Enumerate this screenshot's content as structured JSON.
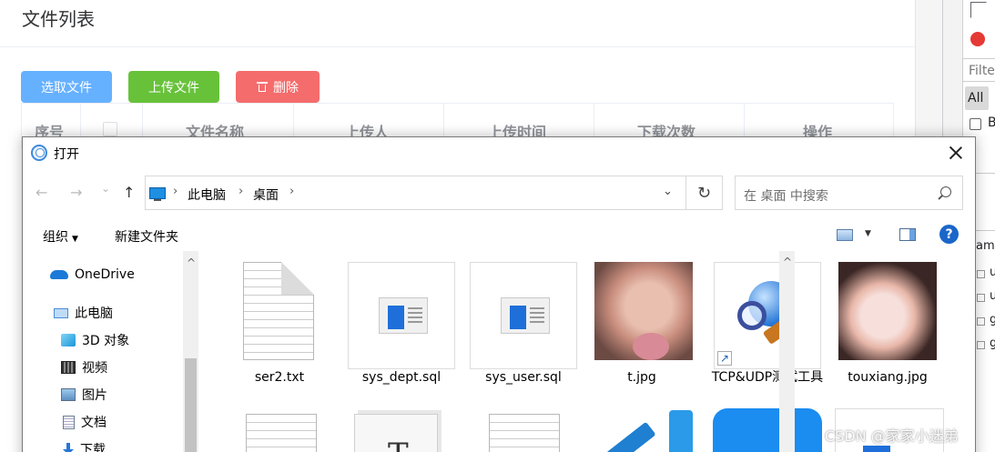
{
  "page": {
    "title": "文件列表",
    "buttons": {
      "select": "选取文件",
      "upload": "上传文件",
      "delete": "删除"
    },
    "table_headers": [
      "序号",
      "文件名称",
      "上传人",
      "上传时间",
      "下载次数",
      "操作"
    ],
    "colors": {
      "select": "#66b1ff",
      "upload": "#67c23a",
      "delete": "#f56c6c"
    }
  },
  "devtools": {
    "filter_placeholder": "Filter",
    "all_label": "All",
    "checkbox_label": "B",
    "column_label": "am",
    "rows": [
      "u",
      "u",
      "g",
      "g"
    ]
  },
  "dialog": {
    "title": "打开",
    "nav": {
      "back": "←",
      "forward": "→",
      "recent": "⌄",
      "up": "↑"
    },
    "address": {
      "segments": [
        "此电脑",
        "桌面"
      ],
      "separator": "›"
    },
    "search_placeholder": "在 桌面 中搜索",
    "toolbar": {
      "organize": "组织",
      "new_folder": "新建文件夹",
      "help": "?"
    },
    "nav_pane": [
      {
        "label": "OneDrive",
        "icon": "onedrive-icon"
      },
      {
        "label": "此电脑",
        "icon": "this-pc-icon"
      },
      {
        "label": "3D 对象",
        "icon": "3d-objects-icon"
      },
      {
        "label": "视频",
        "icon": "videos-icon"
      },
      {
        "label": "图片",
        "icon": "pictures-icon"
      },
      {
        "label": "文档",
        "icon": "documents-icon"
      },
      {
        "label": "下载",
        "icon": "downloads-icon"
      }
    ],
    "files": [
      {
        "name": "ser2.txt",
        "icon": "text-file-icon"
      },
      {
        "name": "sys_dept.sql",
        "icon": "sql-file-icon"
      },
      {
        "name": "sys_user.sql",
        "icon": "sql-file-icon"
      },
      {
        "name": "t.jpg",
        "icon": "photo-thumbnail"
      },
      {
        "name": "TCP&UDP测试工具",
        "icon": "tcp-udp-tool-icon"
      },
      {
        "name": "touxiang.jpg",
        "icon": "photo-thumbnail"
      }
    ]
  },
  "watermark": "CSDN @家家小迷弟"
}
